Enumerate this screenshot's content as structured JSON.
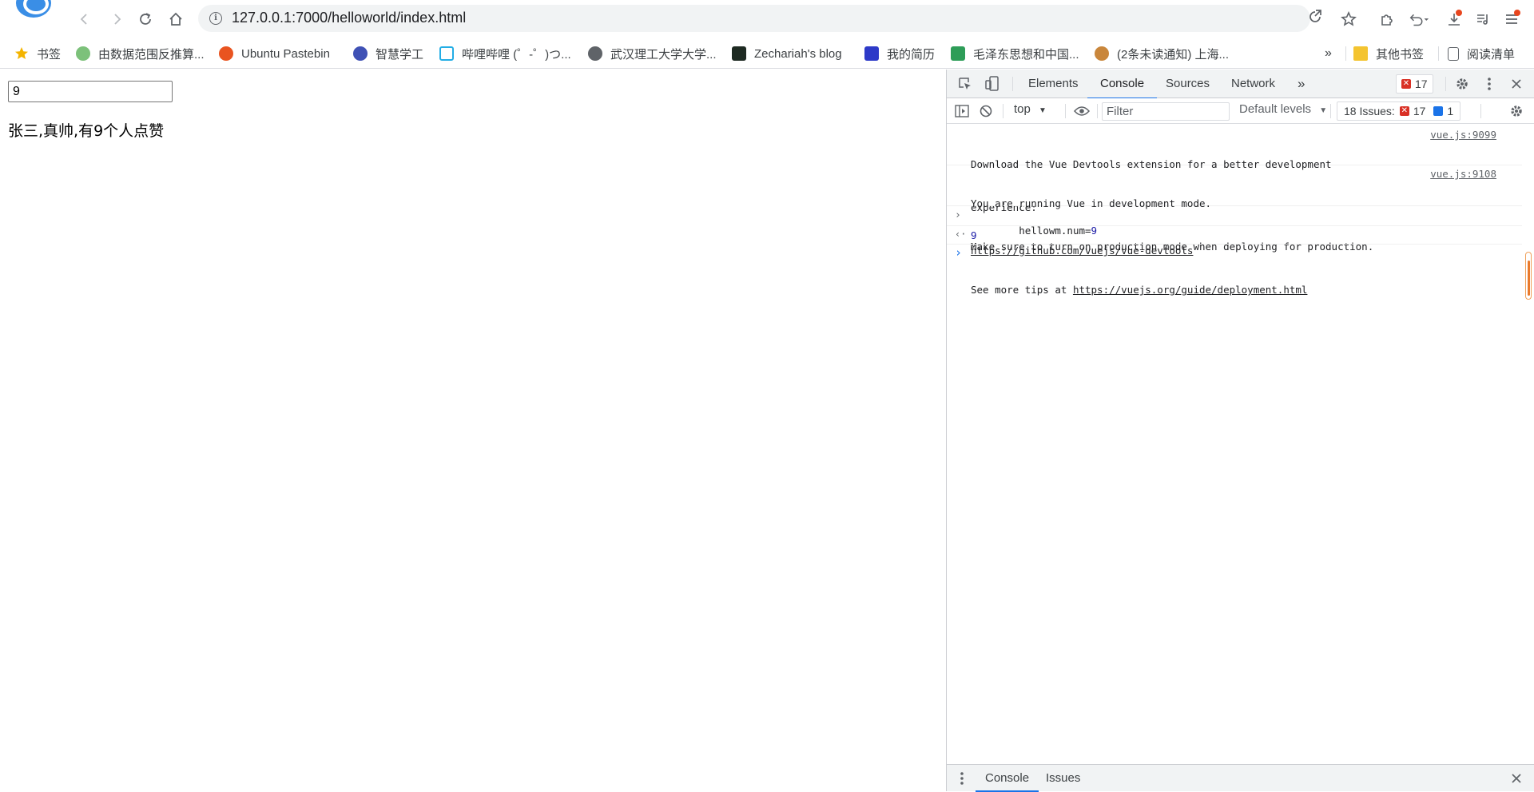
{
  "browser": {
    "url": "127.0.0.1:7000/helloworld/index.html"
  },
  "bookmarks": [
    {
      "label": "书签",
      "color": "#f4b400"
    },
    {
      "label": "由数据范围反推算...",
      "color": "#7cc17a"
    },
    {
      "label": "Ubuntu Pastebin",
      "color": "#e95420"
    },
    {
      "label": "智慧学工",
      "color": "#3f51b5"
    },
    {
      "label": "哔哩哔哩 (゜-゜)つ...",
      "color": "#23ade5"
    },
    {
      "label": "武汉理工大学大学...",
      "color": "#5f6368"
    },
    {
      "label": "Zechariah's blog",
      "color": "#1e2a22"
    },
    {
      "label": "我的简历",
      "color": "#2d3ac8"
    },
    {
      "label": "毛泽东思想和中国...",
      "color": "#2e9d58"
    },
    {
      "label": "(2条未读通知) 上海...",
      "color": "#c9863b"
    }
  ],
  "bookmarks_more": "»",
  "bookmarks_other": "其他书签",
  "bookmarks_reading": "阅读清单",
  "page": {
    "input_value": "9",
    "like_text": "张三,真帅,有9个人点赞"
  },
  "devtools": {
    "tabs": [
      "Elements",
      "Console",
      "Sources",
      "Network"
    ],
    "active_tab": "Console",
    "more_tabs": "»",
    "error_count": "17",
    "context": "top",
    "filter_placeholder": "Filter",
    "levels": "Default levels",
    "issues_label": "18 Issues:",
    "issues_errors": "17",
    "issues_info": "1",
    "messages": [
      {
        "lines": [
          "Download the Vue Devtools extension for a better development",
          "experience:"
        ],
        "link": "https://github.com/vuejs/vue-devtools",
        "source": "vue.js:9099"
      },
      {
        "lines": [
          "You are running Vue in development mode.",
          "Make sure to turn on production mode when deploying for production.",
          "See more tips at "
        ],
        "link": "https://vuejs.org/guide/deployment.html",
        "source": "vue.js:9108"
      }
    ],
    "input_expr_prefix": "hellowm.num=",
    "input_expr_value": "9",
    "result_value": "9",
    "drawer_tabs": [
      "Console",
      "Issues"
    ]
  }
}
